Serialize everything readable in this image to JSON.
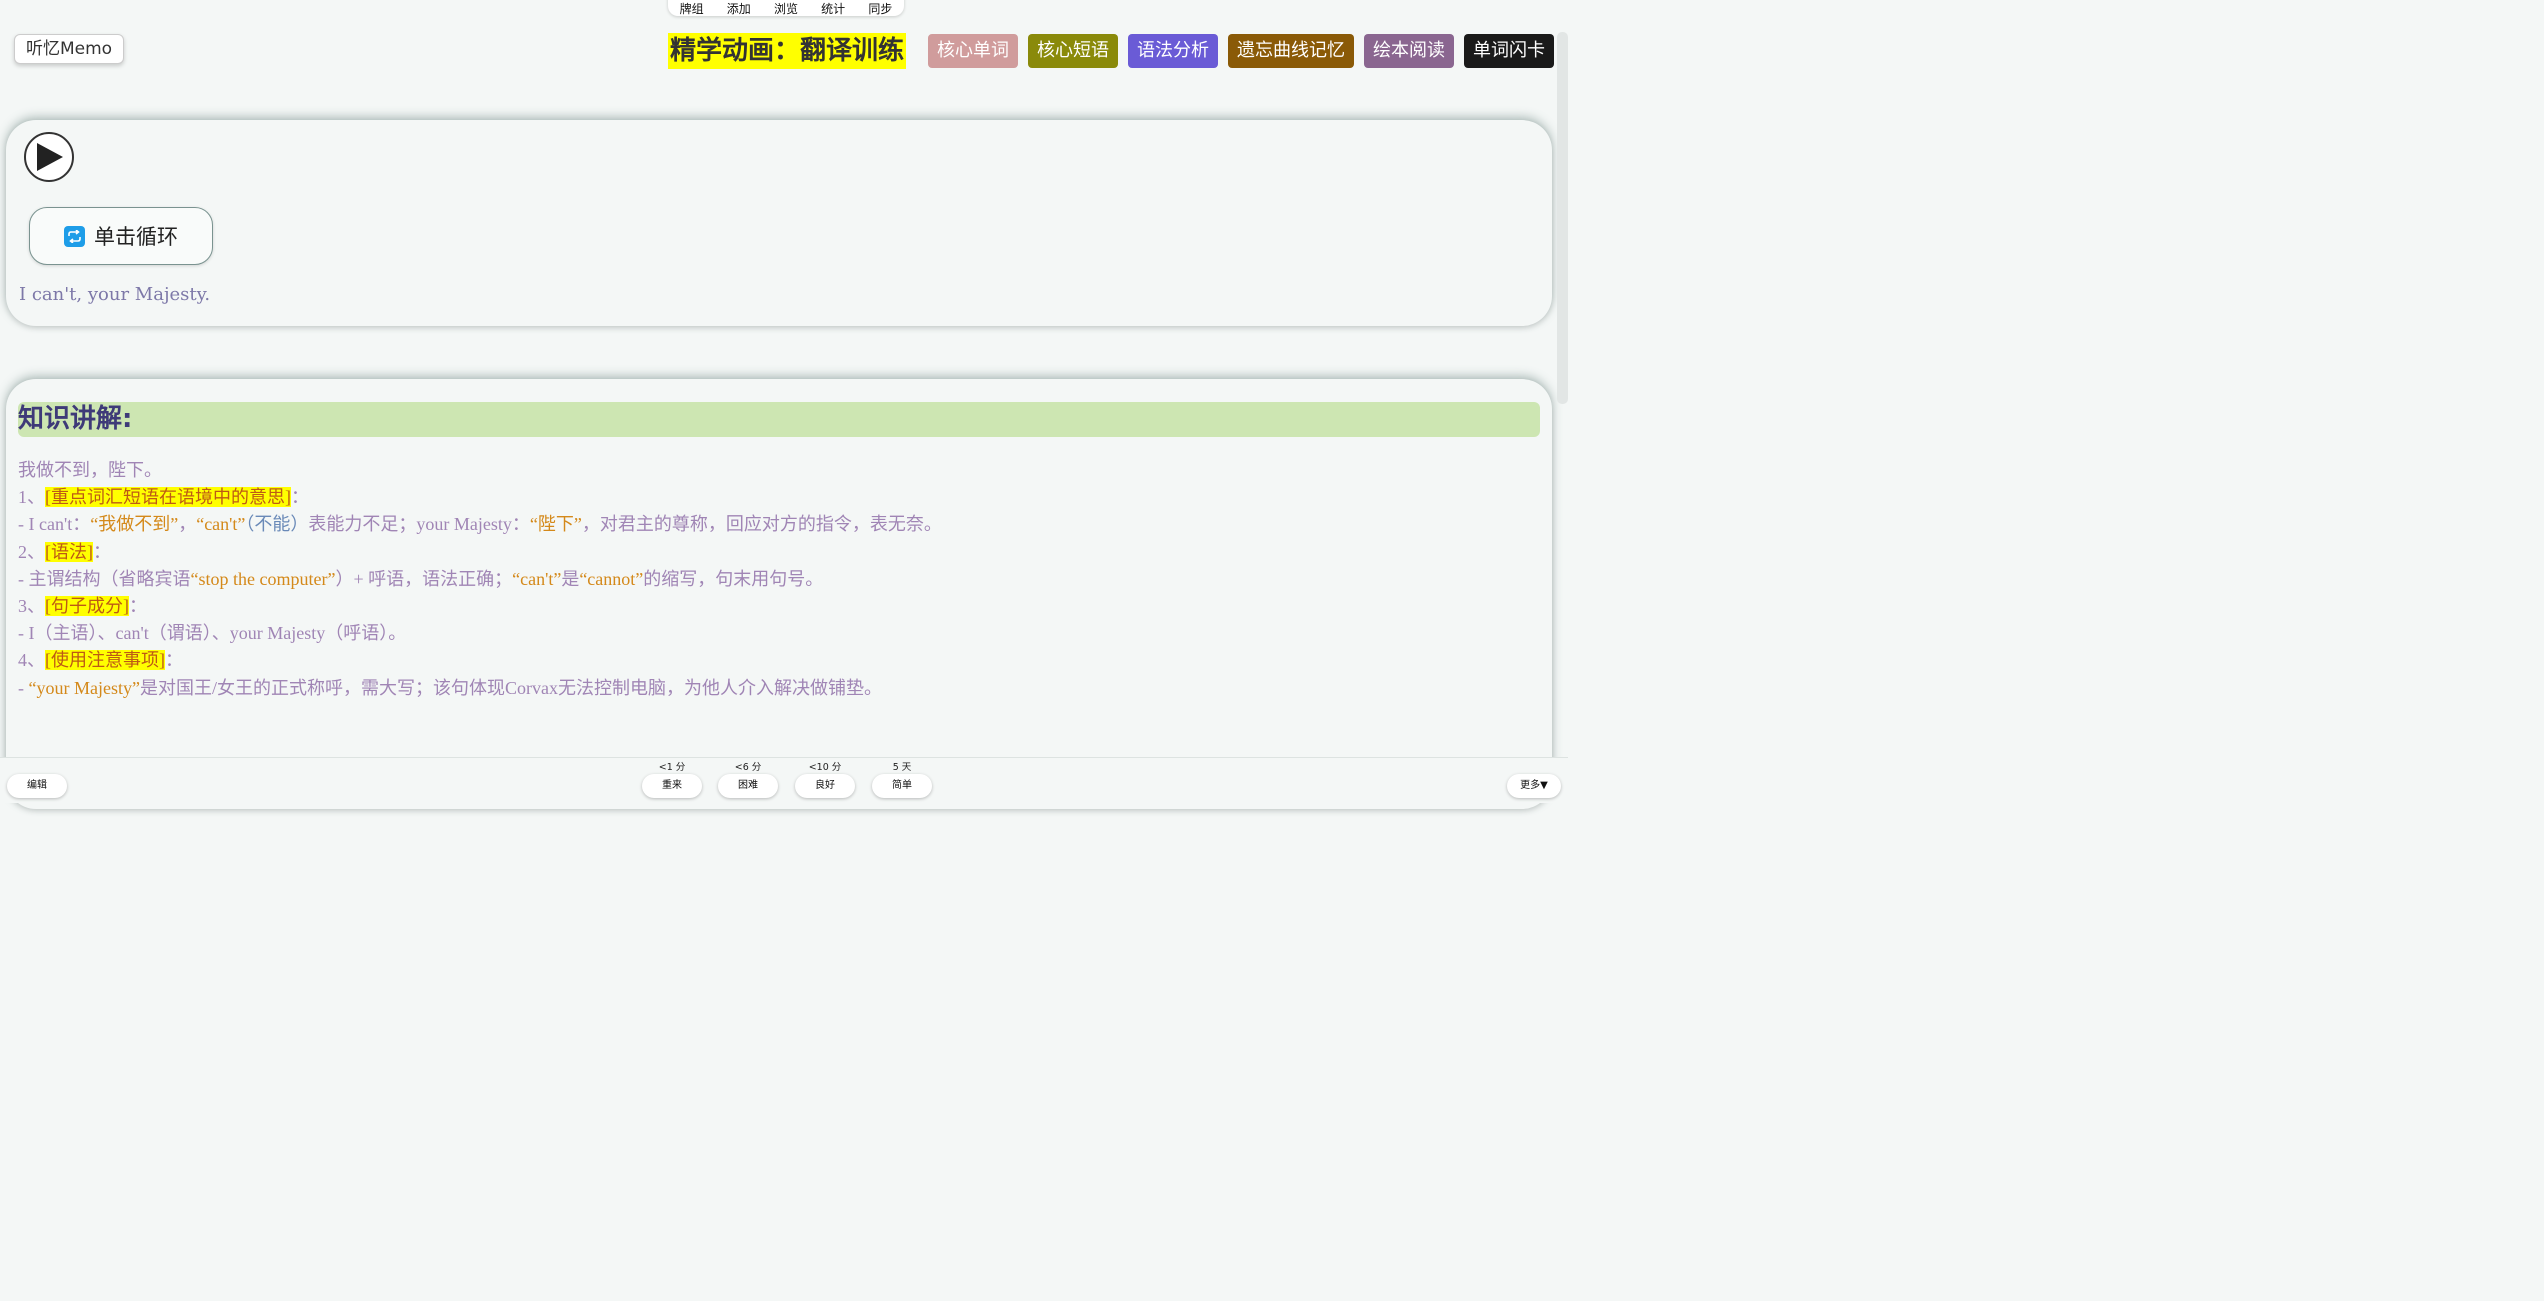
{
  "topnav": [
    "牌组",
    "添加",
    "浏览",
    "统计",
    "同步"
  ],
  "logo": "听忆Memo",
  "menu": {
    "title": "精学动画：翻译训练",
    "tags": [
      {
        "label": "核心单词",
        "color": "#d09c9c"
      },
      {
        "label": "核心短语",
        "color": "#8a8a0a"
      },
      {
        "label": "语法分析",
        "color": "#6a5bd6"
      },
      {
        "label": "遗忘曲线记忆",
        "color": "#8a5a07"
      },
      {
        "label": "绘本阅读",
        "color": "#8a6690"
      },
      {
        "label": "单词闪卡",
        "color": "#1a1a1a"
      }
    ]
  },
  "player": {
    "loop_label": "单击循环"
  },
  "sentence": "I can't, your Majesty.",
  "knowledge": {
    "heading": "知识讲解:",
    "translation": "我做不到，陛下。",
    "s1_num": "1、",
    "s1_title": "[重点词汇短语在语境中的意思]",
    "s1_colon": "：",
    "s1_a": "- I can't：",
    "s1_b": "“我做不到”",
    "s1_c": "，",
    "s1_d": "“can't”",
    "s1_e": "（不能）",
    "s1_f": "表能力不足；your Majesty：",
    "s1_g": "“陛下”",
    "s1_h": "，对君主的尊称，回应对方的指令，表无奈。",
    "s2_num": "2、",
    "s2_title": "[语法]",
    "s2_colon": "：",
    "s2_a": "- 主谓结构（省略宾语",
    "s2_b": "“stop the computer”",
    "s2_c": "）+ 呼语，语法正确；",
    "s2_d": "“can't”",
    "s2_e": "是",
    "s2_f": "“cannot”",
    "s2_g": "的缩写，句末用句号。",
    "s3_num": "3、",
    "s3_title": "[句子成分]",
    "s3_colon": "：",
    "s3_a": "- I（主语）、can't（谓语）、your Majesty（呼语）。",
    "s4_num": "4、",
    "s4_title": "[使用注意事项]",
    "s4_colon": "：",
    "s4_a": "- ",
    "s4_b": "“your Majesty”",
    "s4_c": "是对国王/女王的正式称呼，需大写；该句体现Corvax无法控制电脑，为他人介入解决做铺垫。"
  },
  "bottom": {
    "edit": "编辑",
    "more": "更多▼",
    "answers": [
      {
        "label": "重来",
        "timer": "<1 分"
      },
      {
        "label": "困难",
        "timer": "<6 分"
      },
      {
        "label": "良好",
        "timer": "<10 分"
      },
      {
        "label": "简单",
        "timer": "5 天"
      }
    ]
  }
}
